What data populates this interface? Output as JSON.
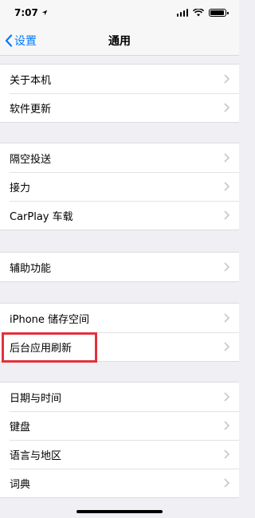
{
  "status_bar": {
    "time": "7:07"
  },
  "nav": {
    "back_label": "设置",
    "title": "通用"
  },
  "groups": [
    {
      "items": [
        "关于本机",
        "软件更新"
      ]
    },
    {
      "items": [
        "隔空投送",
        "接力",
        "CarPlay 车载"
      ]
    },
    {
      "items": [
        "辅助功能"
      ]
    },
    {
      "items": [
        "iPhone 储存空间",
        "后台应用刷新"
      ]
    },
    {
      "items": [
        "日期与时间",
        "键盘",
        "语言与地区",
        "词典"
      ]
    }
  ],
  "highlighted_item": "后台应用刷新",
  "colors": {
    "accent": "#007aff",
    "highlight": "#e3313b",
    "background": "#efeff4"
  }
}
